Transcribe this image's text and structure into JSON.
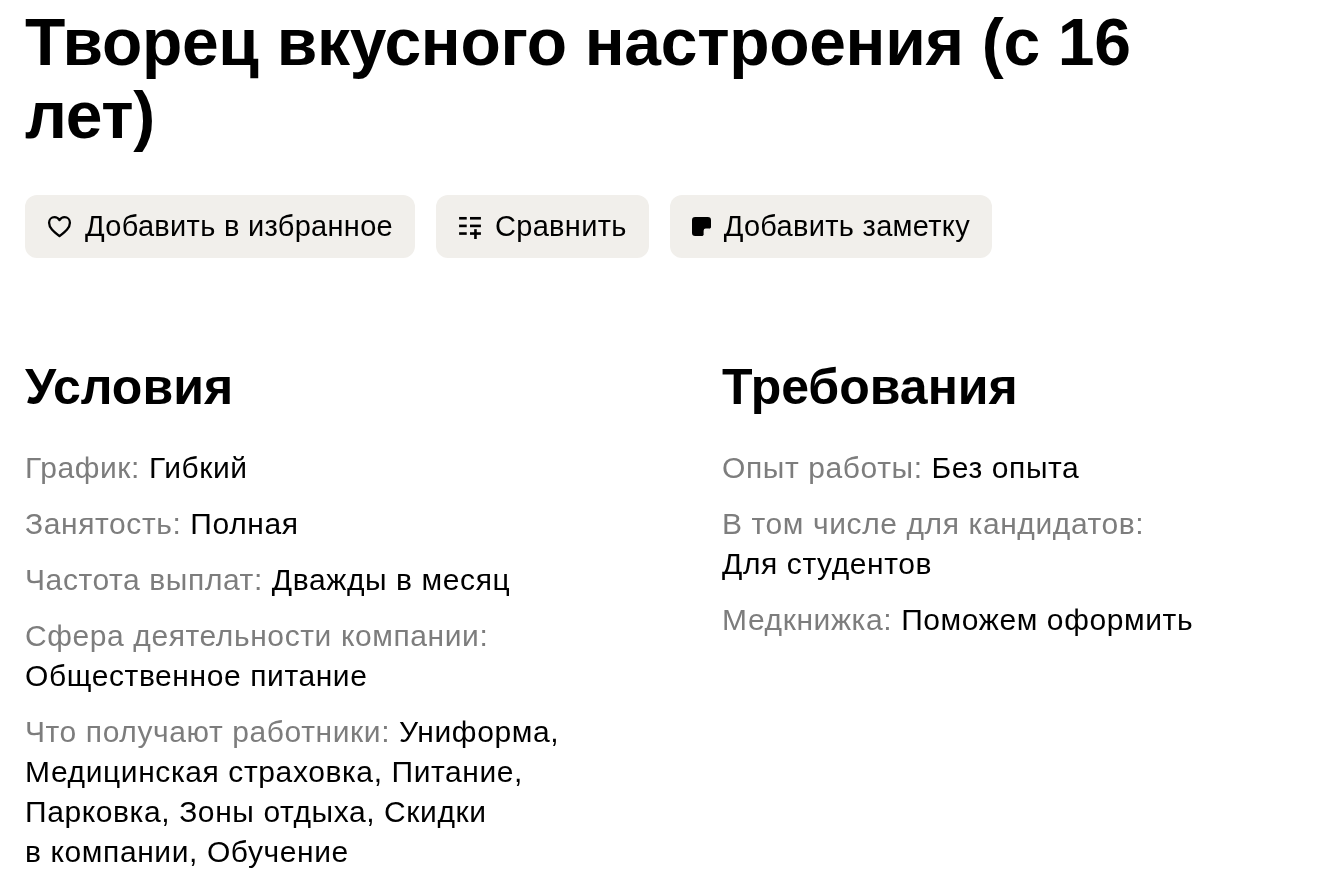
{
  "title": "Творец вкусного настроения (с 16 лет)",
  "actions": [
    {
      "kind": "favorite",
      "label": "Добавить в избранное"
    },
    {
      "kind": "compare",
      "label": "Сравнить"
    },
    {
      "kind": "note",
      "label": "Добавить заметку"
    }
  ],
  "sections": [
    {
      "title": "Условия",
      "items": [
        {
          "label": "График:",
          "value": "Гибкий"
        },
        {
          "label": "Занятость:",
          "value": "Полная"
        },
        {
          "label": "Частота выплат:",
          "value": "Дважды в месяц"
        },
        {
          "label": "Сфера деятельности компании:",
          "value": "Общественное питание"
        },
        {
          "label": "Что получают работники:",
          "value": "Униформа, Медицинская страховка, Питание, Парковка, Зоны отдыха, Скидки в компании, Обучение"
        }
      ]
    },
    {
      "title": "Требования",
      "items": [
        {
          "label": "Опыт работы:",
          "value": "Без опыта"
        },
        {
          "label": "В том числе для кандидатов:",
          "value": "Для студентов"
        },
        {
          "label": "Медкнижка:",
          "value": "Поможем оформить"
        }
      ]
    }
  ]
}
